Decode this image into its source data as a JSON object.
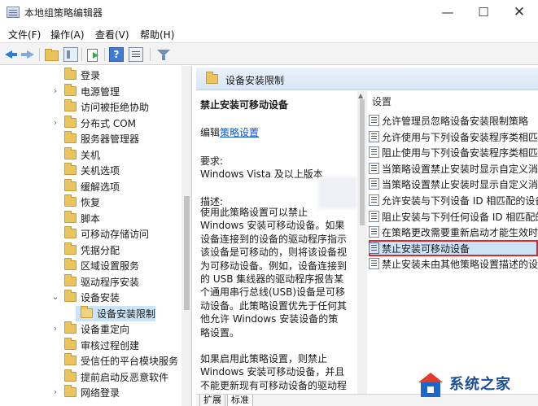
{
  "window": {
    "title": "本地组策略编辑器",
    "minimize": "—",
    "maximize": "☐",
    "close": "✕"
  },
  "menu": {
    "items": [
      "文件(F)",
      "操作(A)",
      "查看(V)",
      "帮助(H)"
    ]
  },
  "tree": {
    "items": [
      {
        "label": "登录",
        "expandable": false
      },
      {
        "label": "电源管理",
        "expandable": true
      },
      {
        "label": "访问被拒绝协助",
        "expandable": false
      },
      {
        "label": "分布式 COM",
        "expandable": true
      },
      {
        "label": "服务器管理器",
        "expandable": false
      },
      {
        "label": "关机",
        "expandable": false
      },
      {
        "label": "关机选项",
        "expandable": false
      },
      {
        "label": "缓解选项",
        "expandable": false
      },
      {
        "label": "恢复",
        "expandable": false
      },
      {
        "label": "脚本",
        "expandable": false
      },
      {
        "label": "可移动存储访问",
        "expandable": false
      },
      {
        "label": "凭据分配",
        "expandable": false
      },
      {
        "label": "区域设置服务",
        "expandable": false
      },
      {
        "label": "驱动程序安装",
        "expandable": false
      },
      {
        "label": "设备安装",
        "expandable": true,
        "expanded": true
      },
      {
        "label": "设备安装限制",
        "child": true,
        "selected": true
      },
      {
        "label": "设备重定向",
        "expandable": true
      },
      {
        "label": "审核过程创建",
        "expandable": false
      },
      {
        "label": "受信任的平台模块服务",
        "expandable": false
      },
      {
        "label": "提前启动反恶意软件",
        "expandable": false
      },
      {
        "label": "网络登录",
        "expandable": true
      }
    ]
  },
  "header": {
    "title": "设备安装限制"
  },
  "description": {
    "title": "禁止安装可移动设备",
    "edit_prefix": "编辑",
    "edit_link": "策略设置",
    "requirements_label": "要求:",
    "requirements_text": "Windows Vista 及以上版本",
    "description_label": "描述:",
    "paragraphs": [
      "使用此策略设置可以禁止 Windows 安装可移动设备。如果设备连接到的设备的驱动程序指示该设备是可移动的，则将该设备视为可移动设备。例如，设备连接到的 USB 集线器的驱动程序报告某个通用串行总线(USB)设备是可移动设备。此策略设置优先于任何其他允许 Windows 安装设备的策略设置。",
      "如果启用此策略设置，则禁止 Windows 安装可移动设备，并且不能更新现有可移动设备的驱动程序。"
    ]
  },
  "settings": {
    "header": "设置",
    "items": [
      "允许管理员忽略设备安装限制策略",
      "允许使用与下列设备安装程序类相匹配的驱动程序安装设备",
      "阻止使用与下列设备安装程序类相匹配的驱动程序安装设备",
      "当策略设置禁止安装时显示自定义消息",
      "当策略设置禁止安装时显示自定义消息标题",
      "允许安装与下列设备 ID 相匹配的设备",
      "阻止安装与下列任何设备 ID 相匹配的设备",
      "在策略更改需要重新启动才能生效时",
      "禁止安装可移动设备",
      "禁止安装未由其他策略设置描述的设备"
    ],
    "selected_index": 8
  },
  "tabs": [
    "扩展",
    "标准"
  ],
  "watermark": {
    "text": "系统之家"
  },
  "colors": {
    "selection": "#cce4f7",
    "highlight_border": "#e0242a",
    "link": "#1155cc"
  }
}
